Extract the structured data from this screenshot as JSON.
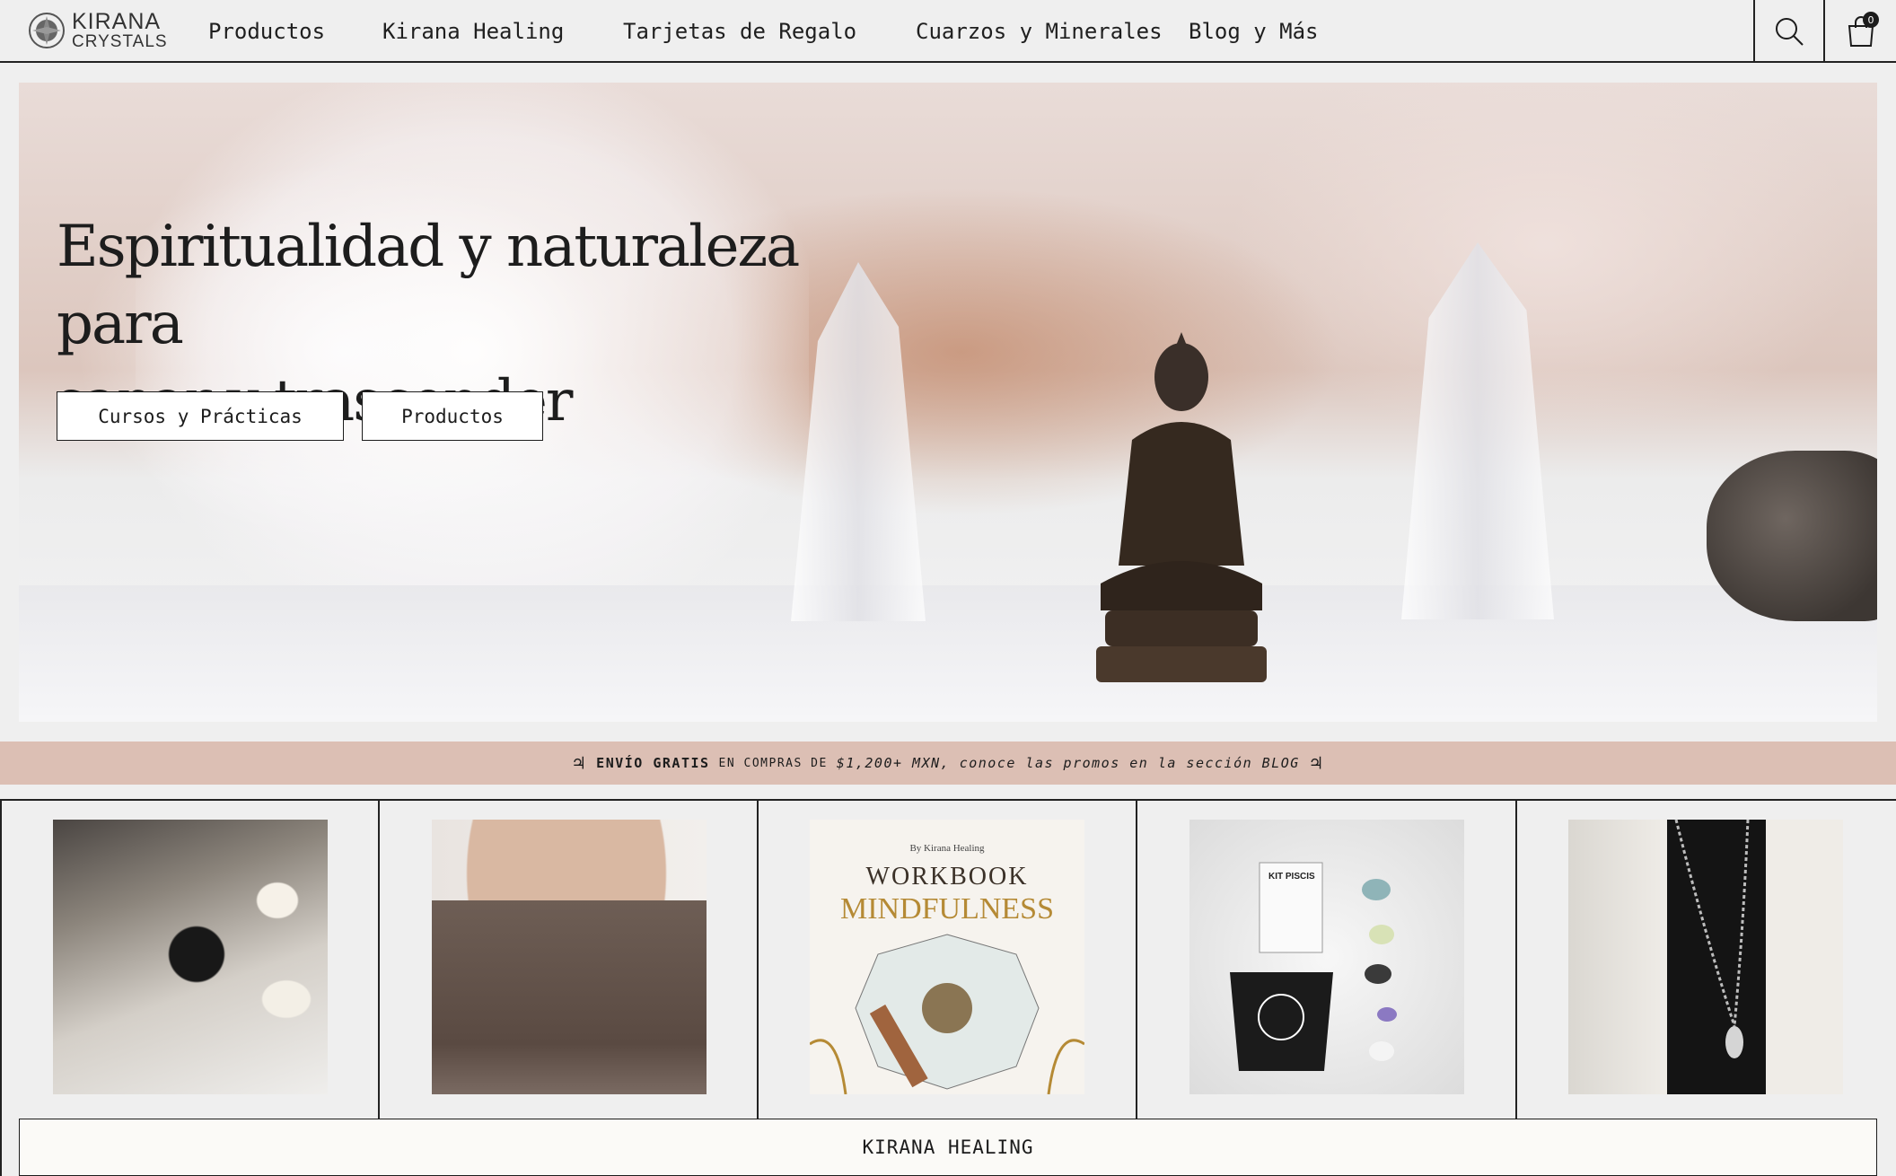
{
  "header": {
    "logo_line1": "KIRANA",
    "logo_line2": "CRYSTALS",
    "nav": [
      "Productos",
      "Kirana Healing",
      "Tarjetas de Regalo",
      "Cuarzos y Minerales",
      "Blog y Más"
    ],
    "search_icon": "search-icon",
    "cart_icon": "bag-icon",
    "cart_count": "0"
  },
  "hero": {
    "title_line1": "Espiritualidad y naturaleza para",
    "title_line2": "sanar y trascender",
    "button1": "Cursos y Prácticas",
    "button2": "Productos"
  },
  "promo": {
    "symbol": "♃",
    "bold": "ENVÍO GRATIS",
    "small": "EN COMPRAS DE",
    "italic": "$1,200+ MXN, conoce las promos en la sección BLOG",
    "bg_color": "#dcbfb4"
  },
  "products": {
    "workbook_by": "By Kirana Healing",
    "workbook_title": "WORKBOOK",
    "workbook_subtitle": "MINDFULNESS",
    "kit_label": "KIT PISCIS"
  },
  "bottom_bar": {
    "label": "KIRANA HEALING"
  }
}
